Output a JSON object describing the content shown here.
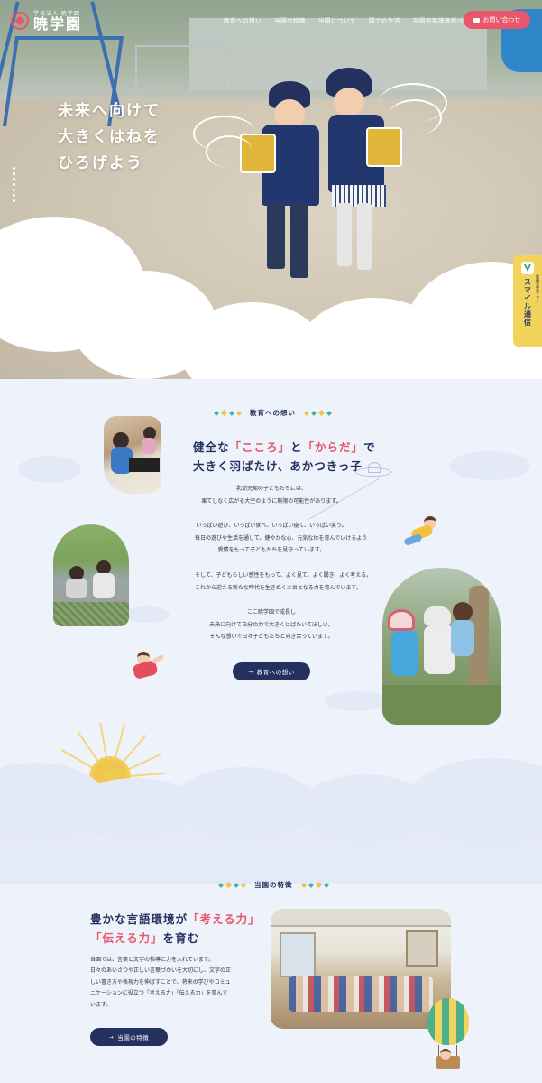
{
  "header": {
    "logo_sub": "学校法人 暁学園",
    "logo_name": "暁学園",
    "nav": [
      "教育への想い",
      "当園の特徴",
      "当園について",
      "園での生活",
      "在園児保護者様ページ"
    ],
    "contact_label": "お問い合わせ"
  },
  "hero": {
    "copy": [
      "未来へ向けて",
      "大きくはねを",
      "ひろげよう"
    ]
  },
  "side_tab": {
    "sub": "保護者専用アプリ",
    "label": "スマイル通信"
  },
  "philosophy": {
    "section_label": "教育への想い",
    "heading_line1": [
      "健全な",
      "「こころ」",
      "と",
      "「からだ」",
      "で"
    ],
    "heading_line2": "大きく羽ばたけ、あかつきっ子",
    "paragraphs": [
      [
        "乳幼児期の子どもたちには、",
        "果てしなく広がる大空のように無限の可能性があります。"
      ],
      [
        "いっぱい遊び、いっぱい食べ、いっぱい寝て、いっぱい笑う。",
        "毎日の遊びや生活を通して、健やかな心、元気な体を育んでいけるよう",
        "愛情をもって子どもたちを見守っています。"
      ],
      [
        "そして、子どもらしい感性をもって、よく見て、よく聞き、よく考える。",
        "これから迎える新たな時代を生きぬく土台となる力を育んでいます。"
      ],
      [
        "ここ暁学園で成長し",
        "未来に向けて自分の力で大きくはばたいてほしい。",
        "そんな想いで日々子どもたちと向き合っています。"
      ]
    ],
    "button": "教育への想い"
  },
  "features": {
    "section_label": "当園の特徴",
    "heading_line1": [
      "豊かな言語環境が",
      "「考える力」"
    ],
    "heading_line2": [
      "「伝える力」",
      "を育む"
    ],
    "paragraph": [
      "当園では、言葉と文字の指導に力を入れています。",
      "日々のあいさつや正しい言葉づかいを大切にし、文字の正",
      "しい書き方や表現力を伸ばすことで、将来の学びやコミュ",
      "ニケーションに役立つ「考える力」「伝える力」を育んで",
      "います。"
    ],
    "button": "当園の特徴"
  },
  "colors": {
    "navy": "#24315f",
    "accent_pink": "#e8566b",
    "tab_yellow": "#f2d35b",
    "deco_green": "#3ab5a0",
    "deco_yellow": "#f0c53c"
  }
}
